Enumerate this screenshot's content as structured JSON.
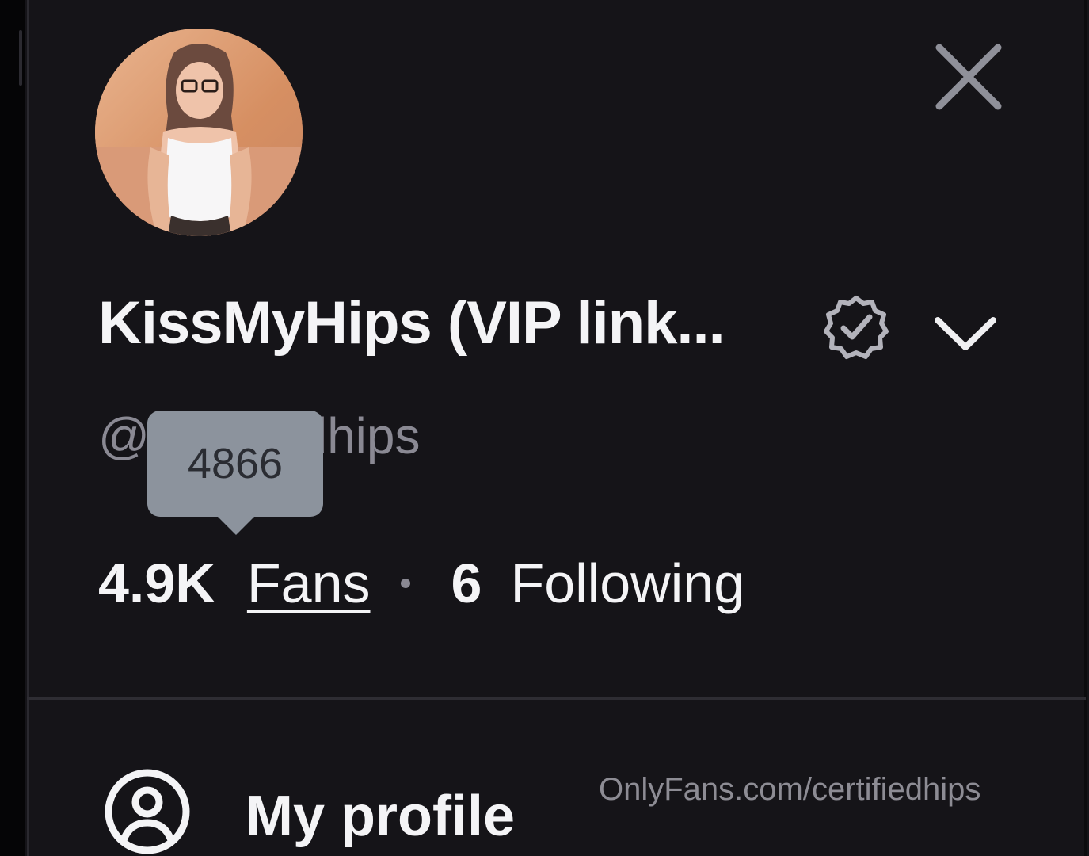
{
  "profile": {
    "display_name": "KissMyHips (VIP link...",
    "username": "@certifiedhips",
    "verified": true
  },
  "tooltip": {
    "text": "4866"
  },
  "stats": {
    "fans_count": "4.9K",
    "fans_label": "Fans",
    "following_count": "6",
    "following_label": "Following"
  },
  "menu": {
    "items": [
      {
        "label": "My profile",
        "icon": "user-circle-icon"
      }
    ]
  },
  "watermark": {
    "text": "OnlyFans.com/certifiedhips"
  },
  "colors": {
    "background": "#151418",
    "text_primary": "#f4f4f6",
    "text_secondary": "#8a8993",
    "tooltip_bg": "#8c939d"
  }
}
